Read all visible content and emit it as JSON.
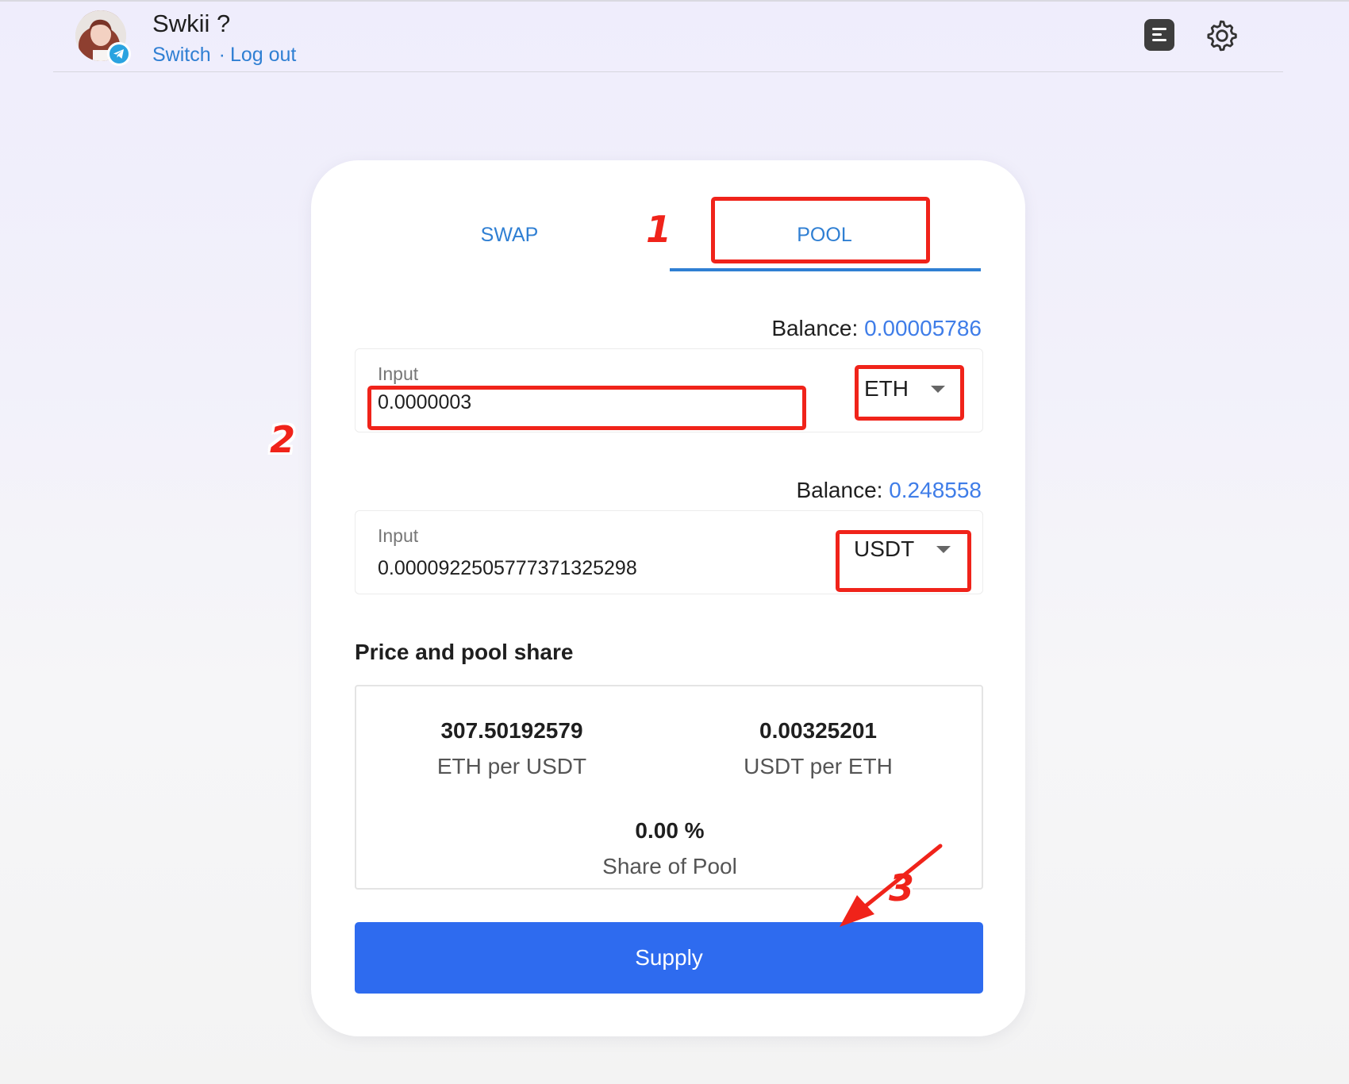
{
  "header": {
    "user_name": "Swkii ?",
    "switch_label": "Switch",
    "separator": "·",
    "logout_label": "Log out",
    "doc_icon": "document-icon",
    "settings_icon": "gear-icon",
    "badge_icon": "telegram-icon"
  },
  "tabs": {
    "swap_label": "SWAP",
    "pool_label": "POOL",
    "active": "POOL"
  },
  "pool": {
    "first": {
      "balance_label": "Balance:",
      "balance_value": "0.00005786",
      "input_label": "Input",
      "input_value": "0.0000003",
      "token": "ETH"
    },
    "second": {
      "balance_label": "Balance:",
      "balance_value": "0.248558",
      "input_label": "Input",
      "input_value": "0.0000922505777371325298",
      "token": "USDT"
    }
  },
  "price_share": {
    "title": "Price and pool share",
    "eth_per_usdt_value": "307.50192579",
    "eth_per_usdt_caption": "ETH per USDT",
    "usdt_per_eth_value": "0.00325201",
    "usdt_per_eth_caption": "USDT per ETH",
    "share_value": "0.00 %",
    "share_caption": "Share of Pool"
  },
  "supply_button": "Supply",
  "annotations": {
    "step1": "1",
    "step2": "2",
    "step3": "3"
  },
  "colors": {
    "accent_link": "#2f7fd3",
    "balance_value": "#3f7de8",
    "primary_button": "#2e6bef",
    "annotation": "#f0231a"
  }
}
